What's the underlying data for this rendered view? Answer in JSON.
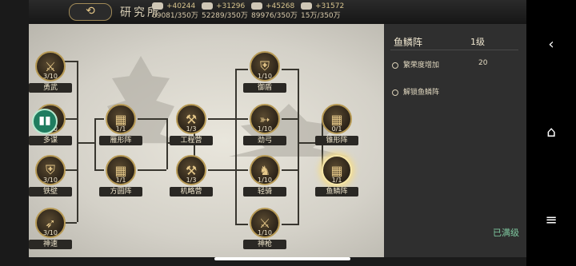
{
  "header": {
    "back_glyph": "⟲",
    "title": "研究所",
    "resources": [
      {
        "icon": "grain-icon",
        "gain": "+40244",
        "amount": "69081/350万"
      },
      {
        "icon": "silver-icon",
        "gain": "+31296",
        "amount": "52289/350万"
      },
      {
        "icon": "wood-icon",
        "gain": "+45268",
        "amount": "89976/350万"
      },
      {
        "icon": "iron-icon",
        "gain": "+31572",
        "amount": "15万/350万"
      }
    ]
  },
  "tree": {
    "nodes": [
      {
        "id": "yongwu",
        "label": "勇武",
        "level": "3/10",
        "glyph": "⚔"
      },
      {
        "id": "duomou",
        "label": "多谋",
        "level": "3/10",
        "glyph": "✎"
      },
      {
        "id": "tiebi",
        "label": "铁壁",
        "level": "3/10",
        "glyph": "⛨"
      },
      {
        "id": "shensu",
        "label": "神速",
        "level": "3/10",
        "glyph": "➶"
      },
      {
        "id": "yanxing",
        "label": "雁形阵",
        "level": "1/1",
        "glyph": "▦"
      },
      {
        "id": "fangyuan",
        "label": "方圆阵",
        "level": "1/1",
        "glyph": "▦"
      },
      {
        "id": "gongcheng",
        "label": "工程营",
        "level": "1/3",
        "glyph": "⚒"
      },
      {
        "id": "jilue",
        "label": "机略营",
        "level": "1/3",
        "glyph": "⚒"
      },
      {
        "id": "yudun",
        "label": "御盾",
        "level": "1/10",
        "glyph": "⛨"
      },
      {
        "id": "jingong",
        "label": "劲弓",
        "level": "1/10",
        "glyph": "➳"
      },
      {
        "id": "qingqi",
        "label": "轻骑",
        "level": "1/10",
        "glyph": "♞"
      },
      {
        "id": "shenqiang",
        "label": "神枪",
        "level": "1/10",
        "glyph": "⚔"
      },
      {
        "id": "zhuixing",
        "label": "锥形阵",
        "level": "0/1",
        "glyph": "▦"
      },
      {
        "id": "yulin",
        "label": "鱼鳞阵",
        "level": "1/1",
        "glyph": "▦"
      }
    ],
    "side_badge_glyph": "▮▮"
  },
  "panel": {
    "title": "鱼鳞阵",
    "level": "1级",
    "rows": [
      {
        "label": "繁荣度增加",
        "value": "20"
      },
      {
        "label": "解锁鱼鳞阵",
        "value": ""
      }
    ],
    "status": "已满级"
  },
  "nav": {
    "back": "‹",
    "home": "⌂",
    "menu": "≡"
  }
}
